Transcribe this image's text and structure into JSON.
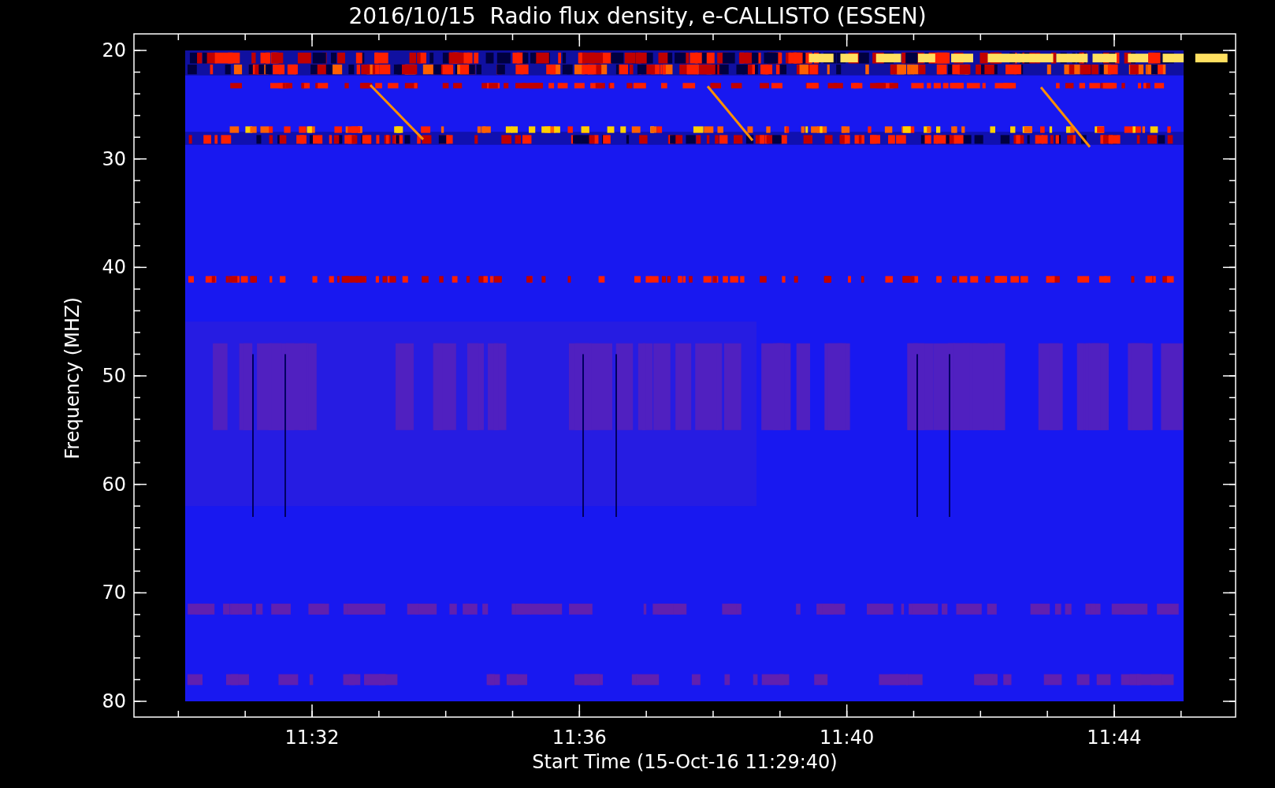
{
  "title": "2016/10/15  Radio flux density, e-CALLISTO (ESSEN)",
  "plot": {
    "ylabel": "Frequency (MHZ)",
    "xlabel": "Start Time (15-Oct-16 11:29:40)",
    "yticks": [
      "20",
      "30",
      "40",
      "50",
      "60",
      "70",
      "80"
    ],
    "xticks": [
      "11:32",
      "11:36",
      "11:40",
      "11:44"
    ]
  }
}
